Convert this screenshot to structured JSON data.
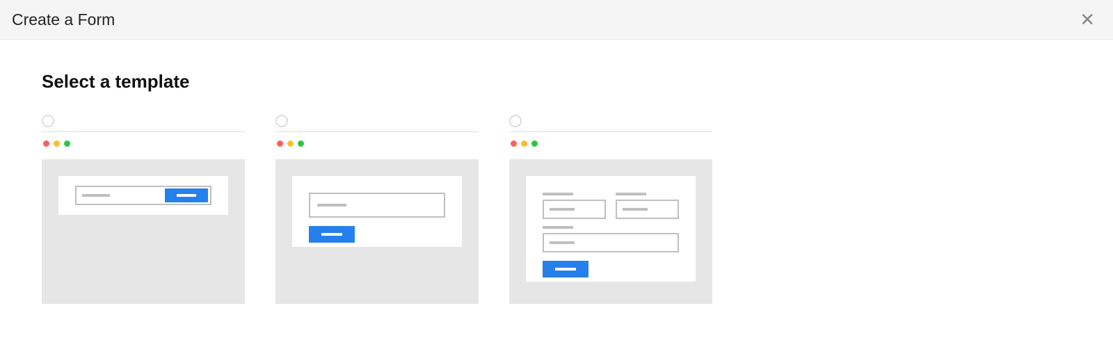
{
  "header": {
    "title": "Create a Form"
  },
  "section": {
    "title": "Select a template"
  },
  "templates": [
    {
      "id": "template-inline-submit",
      "selected": false
    },
    {
      "id": "template-single-field",
      "selected": false
    },
    {
      "id": "template-multi-field",
      "selected": false
    }
  ],
  "colors": {
    "accent": "#2680eb",
    "dot_red": "#ff5f56",
    "dot_yellow": "#ffbd2e",
    "dot_green": "#27c93f",
    "preview_bg": "#e6e6e6",
    "border_gray": "#bfbfbf"
  }
}
